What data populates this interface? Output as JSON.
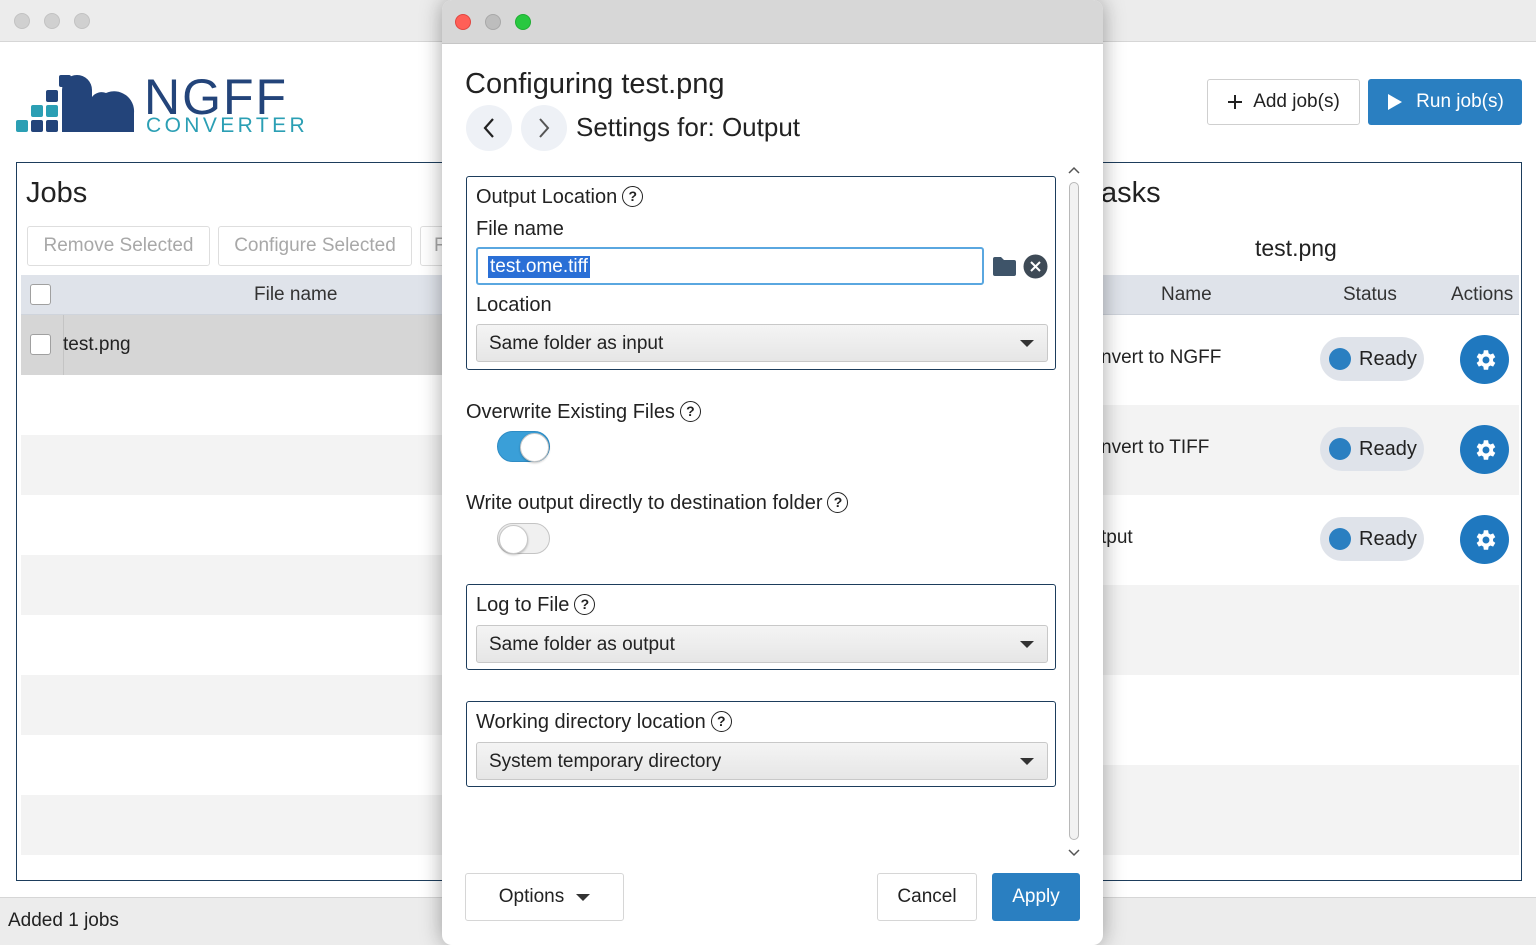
{
  "app": {
    "logo_text": "NGFF",
    "logo_subtext": "CONVERTER",
    "add_jobs_label": "Add job(s)",
    "run_jobs_label": "Run job(s)"
  },
  "jobs_panel": {
    "title": "Jobs",
    "remove_selected_label": "Remove Selected",
    "configure_selected_label": "Configure Selected",
    "partial_button_label": "F",
    "column_file_name": "File name",
    "rows": [
      {
        "file_name": "test.png"
      }
    ]
  },
  "tasks_panel": {
    "title": "asks",
    "subtitle": "test.png",
    "columns": {
      "name": "Name",
      "status": "Status",
      "actions": "Actions"
    },
    "rows": [
      {
        "name": "nvert to NGFF",
        "status": "Ready"
      },
      {
        "name": "nvert to TIFF",
        "status": "Ready"
      },
      {
        "name": "tput",
        "status": "Ready"
      }
    ]
  },
  "status_bar": {
    "text": "Added 1 jobs"
  },
  "dialog": {
    "title": "Configuring test.png",
    "subtitle": "Settings for: Output",
    "output_location": {
      "legend": "Output Location",
      "file_name_label": "File name",
      "file_name_value": "test.ome.tiff",
      "location_label": "Location",
      "location_value": "Same folder as input"
    },
    "overwrite": {
      "label": "Overwrite Existing Files",
      "enabled": true
    },
    "write_direct": {
      "label": "Write output directly to destination folder",
      "enabled": false
    },
    "log_to_file": {
      "legend": "Log to File",
      "value": "Same folder as output"
    },
    "working_dir": {
      "legend": "Working directory location",
      "value": "System temporary directory"
    },
    "options_label": "Options",
    "cancel_label": "Cancel",
    "apply_label": "Apply"
  },
  "colors": {
    "accent": "#2a7fc1",
    "toggle_on": "#3a9fd8",
    "panel_border": "#1d3d5c",
    "logo_dark": "#23447a",
    "logo_teal": "#2b9fb4"
  }
}
